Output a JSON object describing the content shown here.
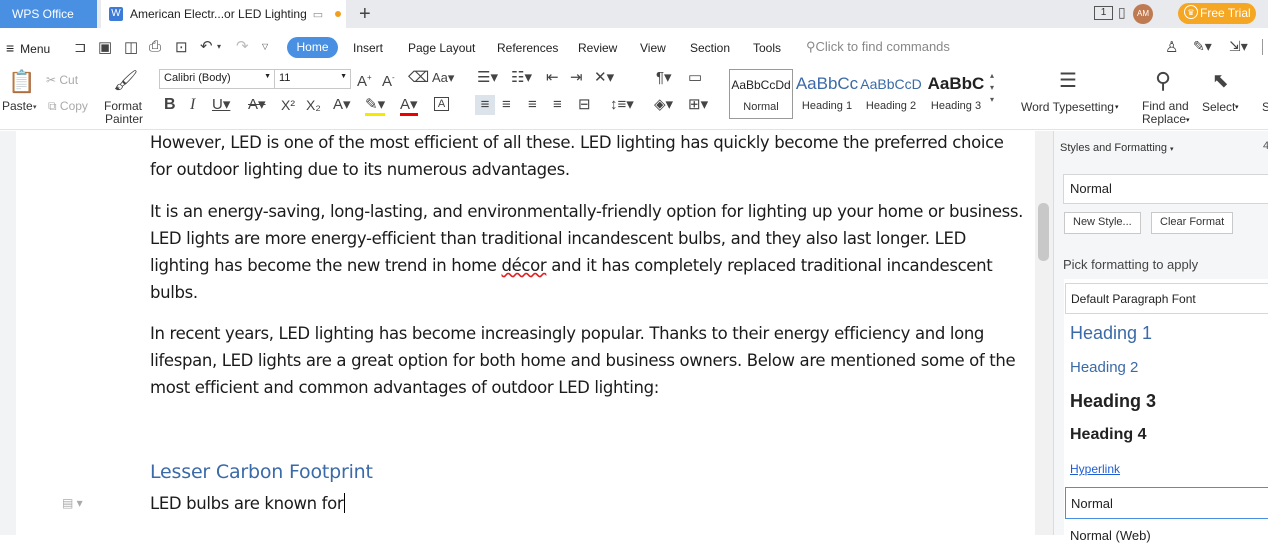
{
  "tabs": {
    "app_tab": "WPS Office",
    "doc_tab": "American Electr...or LED Lighting",
    "free_trial": "Free Trial",
    "avatar_initials": "AM",
    "badge_count": "1"
  },
  "menubar": {
    "menu": "Menu",
    "items": [
      "Home",
      "Insert",
      "Page Layout",
      "References",
      "Review",
      "View",
      "Section",
      "Tools"
    ],
    "search_placeholder": "Click to find commands"
  },
  "ribbon": {
    "paste": "Paste",
    "cut": "Cut",
    "copy": "Copy",
    "format_painter_1": "Format",
    "format_painter_2": "Painter",
    "font_name": "Calibri (Body)",
    "font_size": "11",
    "styles": [
      {
        "preview": "AaBbCcDd",
        "name": "Normal"
      },
      {
        "preview": "AaBbCc",
        "name": "Heading 1"
      },
      {
        "preview": "AaBbCcD",
        "name": "Heading 2"
      },
      {
        "preview": "AaBbC",
        "name": "Heading 3"
      }
    ],
    "word_typesetting": "Word Typesetting",
    "find_replace_1": "Find and",
    "find_replace_2": "Replace",
    "select": "Select",
    "more": "S"
  },
  "document": {
    "para1": "However, LED is one of the most efficient of all these. LED lighting has quickly become the preferred choice for outdoor lighting due to its numerous advantages.",
    "para2_a": "It is an energy-saving, long-lasting, and environmentally-friendly option for lighting up your home or business. LED lights are more energy-efficient than traditional incandescent bulbs, and they also last longer. LED lighting has become the new trend in home ",
    "para2_b": "décor",
    "para2_c": " and it has completely replaced traditional incandescent bulbs.",
    "para3": "In recent years, LED lighting has become increasingly popular. Thanks to their energy efficiency and long lifespan, LED lights are a great option for both home and business owners. Below are mentioned some of the most efficient and common advantages of outdoor LED lighting:",
    "heading": "Lesser Carbon Footprint",
    "para4": "LED bulbs are known for"
  },
  "panel": {
    "title": "Styles and Formatting",
    "current_style": "Normal",
    "new_style": "New Style...",
    "clear_format": "Clear Format",
    "pick_label": "Pick formatting to apply",
    "items": {
      "default_font": "Default Paragraph Font",
      "heading1": "Heading 1",
      "heading2": "Heading 2",
      "heading3": "Heading 3",
      "heading4": "Heading 4",
      "hyperlink": "Hyperlink",
      "normal": "Normal",
      "partial": "Normal (Web)"
    }
  },
  "colors": {
    "accent": "#4a90e2",
    "free_trial": "#f5a623",
    "heading": "#3b6aa8"
  }
}
